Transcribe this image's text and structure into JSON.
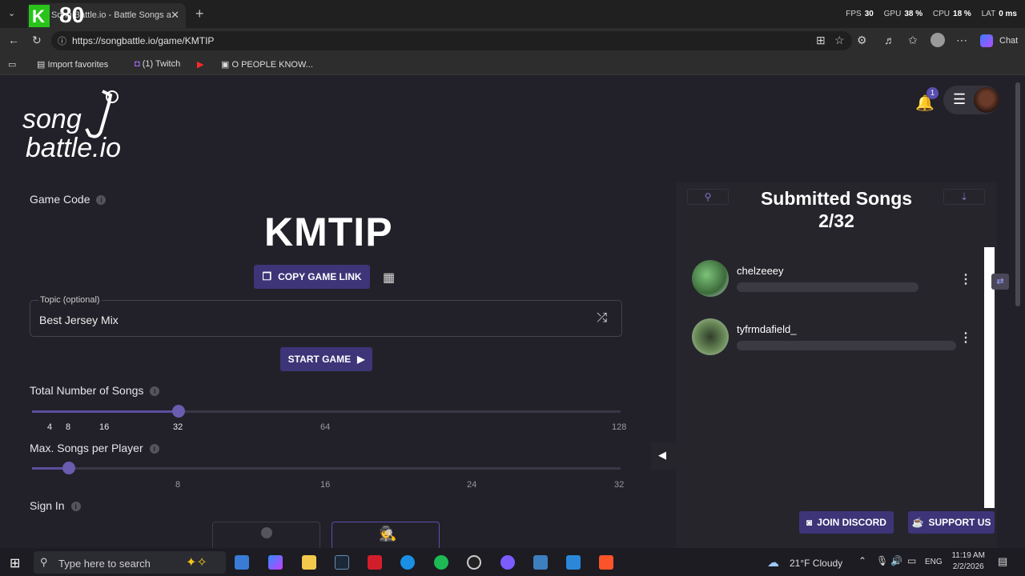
{
  "browser": {
    "tab_title": "Song Battle.io - Battle Songs against",
    "overlay_number": "80",
    "perf": {
      "fps_label": "FPS",
      "fps": "30",
      "gpu_label": "GPU",
      "gpu": "38 %",
      "cpu_label": "CPU",
      "cpu": "18 %",
      "lat_label": "LAT",
      "lat": "0 ms"
    },
    "url": "https://songbattle.io/game/KMTIP",
    "chat_label": "Chat",
    "bookmarks": [
      "Import favorites",
      "(1) Twitch",
      "O PEOPLE KNOW..."
    ]
  },
  "page": {
    "logo_line1": "song",
    "logo_line2": "battle.io",
    "notification_count": "1",
    "game_code_label": "Game Code",
    "game_code": "KMTIP",
    "copy_link_label": "COPY GAME LINK",
    "topic_label": "Topic (optional)",
    "topic_value": "Best Jersey Mix",
    "start_label": "START GAME",
    "total_songs_label": "Total Number of Songs",
    "total_songs_ticks": [
      "4",
      "8",
      "16",
      "32",
      "64",
      "128"
    ],
    "total_songs_value": 32,
    "max_songs_label": "Max. Songs per Player",
    "max_songs_ticks": [
      "8",
      "16",
      "24",
      "32"
    ],
    "max_songs_value": 4,
    "sign_in_label": "Sign In"
  },
  "panel": {
    "title_line1": "Submitted Songs",
    "title_line2": "2/32",
    "players": [
      {
        "name": "chelzeeey"
      },
      {
        "name": "tyfrmdafield_"
      }
    ],
    "join_discord_label": "JOIN DISCORD",
    "support_label": "SUPPORT US"
  },
  "taskbar": {
    "search_placeholder": "Type here to search",
    "weather": "21°F  Cloudy",
    "lang": "ENG",
    "time": "11:19 AM",
    "date": "2/2/2026"
  },
  "colors": {
    "accent": "#3d3578",
    "page_bg": "#222129",
    "panel_bg": "#26252c"
  }
}
